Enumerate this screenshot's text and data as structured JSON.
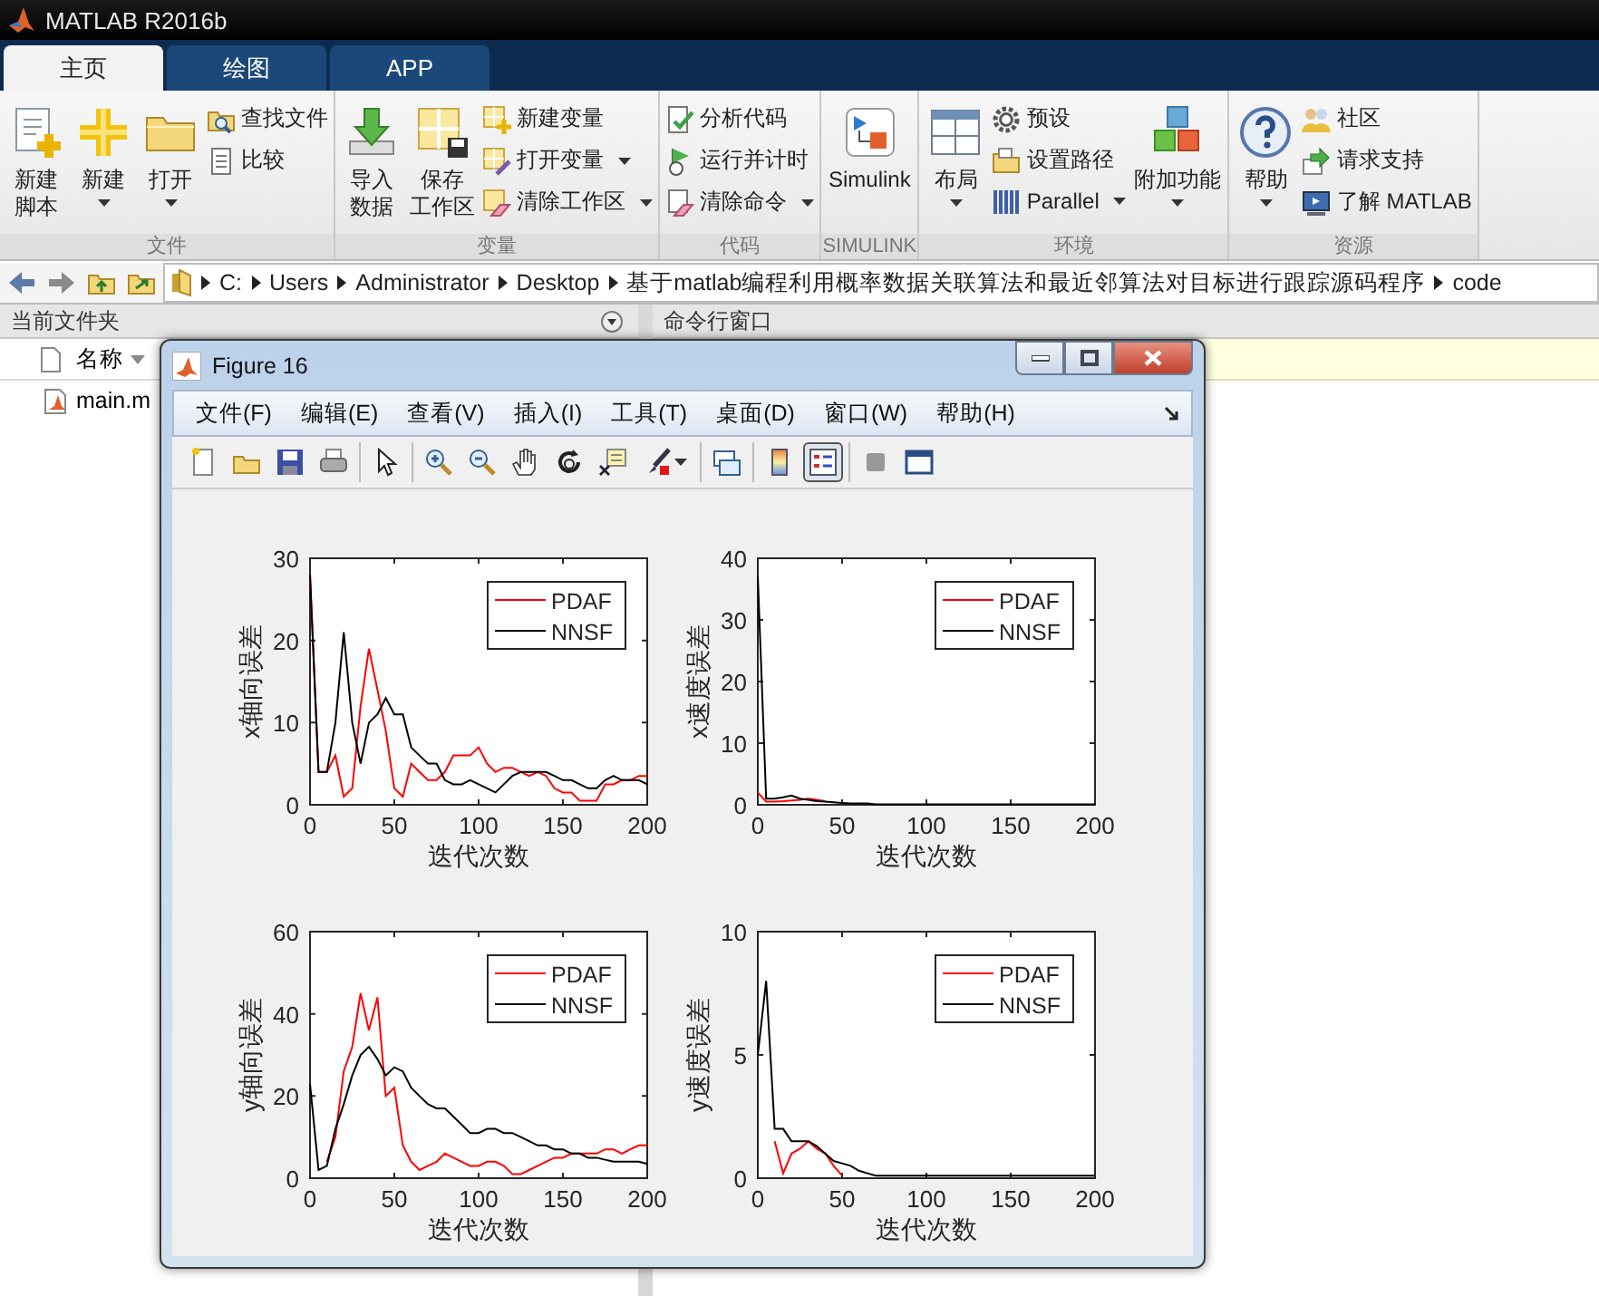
{
  "window": {
    "title": "MATLAB R2016b"
  },
  "tabs": [
    {
      "label": "主页",
      "selected": true
    },
    {
      "label": "绘图",
      "selected": false
    },
    {
      "label": "APP",
      "selected": false
    }
  ],
  "toolstrip": [
    {
      "label": "文件",
      "items": [
        {
          "kind": "large",
          "lines": [
            "新建",
            "脚本"
          ],
          "dropdown": false
        },
        {
          "kind": "large",
          "lines": [
            "新建"
          ],
          "dropdown": true
        },
        {
          "kind": "large",
          "lines": [
            "打开"
          ],
          "dropdown": true
        },
        {
          "kind": "stack",
          "buttons": [
            {
              "label": "查找文件",
              "dropdown": false
            },
            {
              "label": "比较",
              "dropdown": false
            }
          ]
        }
      ]
    },
    {
      "label": "变量",
      "items": [
        {
          "kind": "large",
          "lines": [
            "导入",
            "数据"
          ],
          "dropdown": false
        },
        {
          "kind": "large",
          "lines": [
            "保存",
            "工作区"
          ],
          "dropdown": false
        },
        {
          "kind": "stack",
          "buttons": [
            {
              "label": "新建变量",
              "dropdown": false
            },
            {
              "label": "打开变量",
              "dropdown": true
            },
            {
              "label": "清除工作区",
              "dropdown": true
            }
          ]
        }
      ]
    },
    {
      "label": "代码",
      "items": [
        {
          "kind": "stack",
          "buttons": [
            {
              "label": "分析代码",
              "dropdown": false
            },
            {
              "label": "运行并计时",
              "dropdown": false
            },
            {
              "label": "清除命令",
              "dropdown": true
            }
          ]
        }
      ]
    },
    {
      "label": "SIMULINK",
      "items": [
        {
          "kind": "large",
          "lines": [
            "Simulink"
          ],
          "dropdown": false
        }
      ]
    },
    {
      "label": "环境",
      "items": [
        {
          "kind": "large",
          "lines": [
            "布局"
          ],
          "dropdown": true
        },
        {
          "kind": "stack",
          "buttons": [
            {
              "label": "预设",
              "dropdown": false
            },
            {
              "label": "设置路径",
              "dropdown": false
            },
            {
              "label": "Parallel",
              "dropdown": true
            }
          ]
        },
        {
          "kind": "large",
          "lines": [
            "附加功能"
          ],
          "dropdown": true
        }
      ]
    },
    {
      "label": "资源",
      "items": [
        {
          "kind": "large",
          "lines": [
            "帮助"
          ],
          "dropdown": true
        },
        {
          "kind": "stack",
          "buttons": [
            {
              "label": "社区",
              "dropdown": false
            },
            {
              "label": "请求支持",
              "dropdown": false
            },
            {
              "label": "了解 MATLAB",
              "dropdown": false
            }
          ]
        }
      ]
    }
  ],
  "address_bar": {
    "path": [
      "C:",
      "Users",
      "Administrator",
      "Desktop",
      "基于matlab编程利用概率数据关联算法和最近邻算法对目标进行跟踪源码程序",
      "code"
    ]
  },
  "current_folder": {
    "title": "当前文件夹",
    "column": "名称",
    "files": [
      {
        "name": "main.m"
      }
    ]
  },
  "command_window": {
    "title": "命令行窗口"
  },
  "figure": {
    "title": "Figure 16",
    "menu": [
      "文件(F)",
      "编辑(E)",
      "查看(V)",
      "插入(I)",
      "工具(T)",
      "桌面(D)",
      "窗口(W)",
      "帮助(H)"
    ],
    "toolbar": [
      [
        {
          "selected": false
        },
        {
          "selected": false
        },
        {
          "selected": false
        },
        {
          "selected": false
        }
      ],
      [
        {
          "selected": false
        }
      ],
      [
        {
          "selected": false
        },
        {
          "selected": false
        },
        {
          "selected": false
        },
        {
          "selected": false
        },
        {
          "selected": false
        },
        {
          "selected": false
        }
      ],
      [
        {
          "selected": false
        }
      ],
      [
        {
          "selected": false
        },
        {
          "selected": true
        }
      ],
      [
        {
          "selected": false
        },
        {
          "selected": false
        }
      ]
    ],
    "charts": [
      {
        "chart_data": {
          "type": "line",
          "xlabel": "迭代次数",
          "ylabel": "x轴向误差",
          "x": [
            0,
            5,
            10,
            15,
            20,
            25,
            30,
            35,
            40,
            45,
            50,
            55,
            60,
            65,
            70,
            75,
            80,
            85,
            90,
            95,
            100,
            105,
            110,
            115,
            120,
            125,
            130,
            135,
            140,
            145,
            150,
            155,
            160,
            165,
            170,
            175,
            180,
            185,
            190,
            195,
            200
          ],
          "legend": true,
          "xlim": [
            0,
            200
          ],
          "ylim": [
            0,
            30
          ],
          "xticks": [
            0,
            50,
            100,
            150,
            200
          ],
          "yticks": [
            0,
            10,
            20,
            30
          ],
          "series": [
            {
              "name": "PDAF",
              "color": "#ff0000",
              "values": [
                28,
                4,
                4,
                6,
                1,
                2,
                12,
                19,
                14,
                9,
                2,
                1,
                5,
                4,
                3,
                3,
                4,
                6,
                6,
                6,
                7,
                5,
                4,
                4.5,
                4.5,
                4,
                3.5,
                4,
                3.5,
                2,
                1.5,
                1.5,
                0.5,
                0.5,
                0.5,
                2.5,
                2.5,
                3,
                3,
                3.5,
                3.5
              ]
            },
            {
              "name": "NNSF",
              "color": "#000000",
              "values": [
                28,
                4,
                4,
                10,
                21,
                10,
                5,
                10,
                11,
                13,
                11,
                11,
                7,
                6,
                5,
                5,
                3,
                2.5,
                2.5,
                3,
                2.5,
                2,
                1.5,
                2.5,
                3.5,
                4,
                4,
                4,
                4,
                3.5,
                3,
                3,
                2.5,
                2,
                2,
                3,
                3.5,
                3,
                3,
                3,
                2.5
              ]
            }
          ]
        }
      },
      {
        "chart_data": {
          "type": "line",
          "xlabel": "迭代次数",
          "ylabel": "x速度误差",
          "x": [
            0,
            5,
            10,
            15,
            20,
            25,
            30,
            35,
            40,
            45,
            50,
            55,
            60,
            65,
            70,
            75,
            80,
            85,
            90,
            95,
            100,
            105,
            110,
            115,
            120,
            125,
            130,
            135,
            140,
            145,
            150,
            155,
            160,
            165,
            170,
            175,
            180,
            185,
            190,
            195,
            200
          ],
          "legend": true,
          "xlim": [
            0,
            200
          ],
          "ylim": [
            0,
            40
          ],
          "xticks": [
            0,
            50,
            100,
            150,
            200
          ],
          "yticks": [
            0,
            10,
            20,
            30,
            40
          ],
          "series": [
            {
              "name": "PDAF",
              "color": "#ff0000",
              "values": [
                2,
                0.5,
                0.5,
                0.6,
                0.7,
                0.8,
                1,
                0.8,
                0.6,
                null,
                null,
                null,
                null,
                null,
                null,
                null,
                null,
                null,
                null,
                null,
                null,
                null,
                null,
                null,
                null,
                null,
                null,
                null,
                null,
                null,
                null,
                null,
                null,
                null,
                null,
                null,
                null,
                null,
                null,
                null,
                null
              ]
            },
            {
              "name": "NNSF",
              "color": "#000000",
              "values": [
                37,
                1,
                1,
                1.2,
                1.5,
                1,
                0.8,
                0.6,
                0.5,
                0.4,
                0.3,
                0.2,
                0.2,
                0.2,
                0.1,
                0.1,
                0.1,
                0.1,
                0.1,
                0.1,
                0.1,
                0.1,
                0.1,
                0.1,
                0.1,
                0.1,
                0.1,
                0.1,
                0.1,
                0.1,
                0.1,
                0.1,
                0.1,
                0.1,
                0.1,
                0.1,
                0.1,
                0.1,
                0.1,
                0.1,
                0.1
              ]
            }
          ]
        }
      },
      {
        "chart_data": {
          "type": "line",
          "xlabel": "迭代次数",
          "ylabel": "y轴向误差",
          "x": [
            0,
            5,
            10,
            15,
            20,
            25,
            30,
            35,
            40,
            45,
            50,
            55,
            60,
            65,
            70,
            75,
            80,
            85,
            90,
            95,
            100,
            105,
            110,
            115,
            120,
            125,
            130,
            135,
            140,
            145,
            150,
            155,
            160,
            165,
            170,
            175,
            180,
            185,
            190,
            195,
            200
          ],
          "legend": true,
          "xlim": [
            0,
            200
          ],
          "ylim": [
            0,
            60
          ],
          "xticks": [
            0,
            50,
            100,
            150,
            200
          ],
          "yticks": [
            0,
            20,
            40,
            60
          ],
          "series": [
            {
              "name": "PDAF",
              "color": "#ff0000",
              "values": [
                null,
                null,
                4,
                10,
                26,
                32,
                45,
                36,
                44,
                20,
                22,
                8,
                4,
                2,
                3,
                4,
                6,
                5,
                4,
                3,
                3,
                4,
                4,
                3,
                1,
                1,
                2,
                3,
                4,
                5,
                5,
                6,
                6,
                6,
                6,
                7,
                7,
                6,
                7,
                8,
                8
              ]
            },
            {
              "name": "NNSF",
              "color": "#000000",
              "values": [
                23,
                2,
                3,
                12,
                18,
                25,
                30,
                32,
                29,
                25,
                27,
                26,
                22,
                20,
                18,
                17,
                17,
                15,
                13,
                11,
                11,
                12,
                12,
                11,
                11,
                10,
                9,
                8,
                8,
                7,
                7,
                6,
                6,
                5,
                5,
                4.5,
                4,
                4,
                4,
                4,
                3.5
              ]
            }
          ]
        }
      },
      {
        "chart_data": {
          "type": "line",
          "xlabel": "迭代次数",
          "ylabel": "y速度误差",
          "x": [
            0,
            5,
            10,
            15,
            20,
            25,
            30,
            35,
            40,
            45,
            50,
            55,
            60,
            65,
            70,
            75,
            80,
            85,
            90,
            95,
            100,
            105,
            110,
            115,
            120,
            125,
            130,
            135,
            140,
            145,
            150,
            155,
            160,
            165,
            170,
            175,
            180,
            185,
            190,
            195,
            200
          ],
          "legend": true,
          "xlim": [
            0,
            200
          ],
          "ylim": [
            0,
            10
          ],
          "xticks": [
            0,
            50,
            100,
            150,
            200
          ],
          "yticks": [
            0,
            5,
            10
          ],
          "series": [
            {
              "name": "PDAF",
              "color": "#ff0000",
              "values": [
                null,
                null,
                1.5,
                0.2,
                1,
                1.2,
                1.5,
                1.2,
                1,
                0.5,
                0.1,
                null,
                null,
                null,
                null,
                null,
                null,
                null,
                null,
                null,
                null,
                null,
                null,
                null,
                null,
                null,
                null,
                null,
                null,
                null,
                null,
                null,
                null,
                null,
                null,
                null,
                null,
                null,
                null,
                null,
                null
              ]
            },
            {
              "name": "NNSF",
              "color": "#000000",
              "values": [
                5,
                8,
                2,
                2,
                1.5,
                1.5,
                1.5,
                1.3,
                1,
                0.7,
                0.6,
                0.5,
                0.3,
                0.2,
                0.1,
                0.1,
                0.1,
                0.1,
                0.1,
                0.1,
                0.1,
                0.1,
                0.1,
                0.1,
                0.1,
                0.1,
                0.1,
                0.1,
                0.1,
                0.1,
                0.1,
                0.1,
                0.1,
                0.1,
                0.1,
                0.1,
                0.1,
                0.1,
                0.1,
                0.1,
                0.1
              ]
            }
          ]
        }
      }
    ]
  }
}
